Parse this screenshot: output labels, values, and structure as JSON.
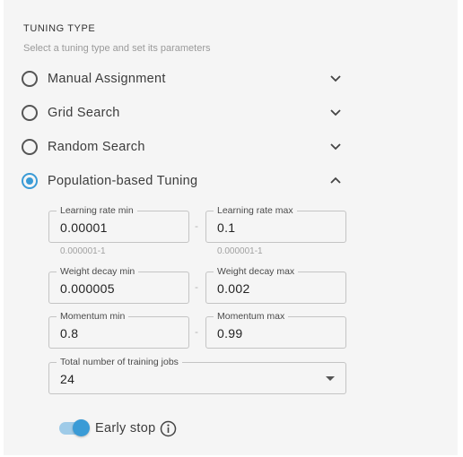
{
  "section": {
    "title": "TUNING TYPE",
    "subtitle": "Select a tuning type and set its parameters"
  },
  "options": [
    {
      "label": "Manual Assignment",
      "selected": false,
      "expanded": false
    },
    {
      "label": "Grid Search",
      "selected": false,
      "expanded": false
    },
    {
      "label": "Random Search",
      "selected": false,
      "expanded": false
    },
    {
      "label": "Population-based Tuning",
      "selected": true,
      "expanded": true
    }
  ],
  "params": {
    "learning_rate": {
      "min_label": "Learning rate min",
      "min_value": "0.00001",
      "max_label": "Learning rate max",
      "max_value": "0.1",
      "min_helper": "0.000001-1",
      "max_helper": "0.000001-1"
    },
    "weight_decay": {
      "min_label": "Weight decay min",
      "min_value": "0.000005",
      "max_label": "Weight decay max",
      "max_value": "0.002"
    },
    "momentum": {
      "min_label": "Momentum min",
      "min_value": "0.8",
      "max_label": "Momentum max",
      "max_value": "0.99"
    },
    "separator": "-",
    "jobs": {
      "label": "Total number of training jobs",
      "value": "24"
    }
  },
  "early_stop": {
    "label": "Early stop",
    "enabled": true
  },
  "icons": {
    "collapsed": "chevron-down-icon",
    "expanded": "chevron-up-icon",
    "info": "info-icon",
    "select": "dropdown-arrow-icon"
  },
  "colors": {
    "accent": "#3a9bd6",
    "accent_light": "#9fcbe8",
    "panel_bg": "#f5f5f5"
  }
}
